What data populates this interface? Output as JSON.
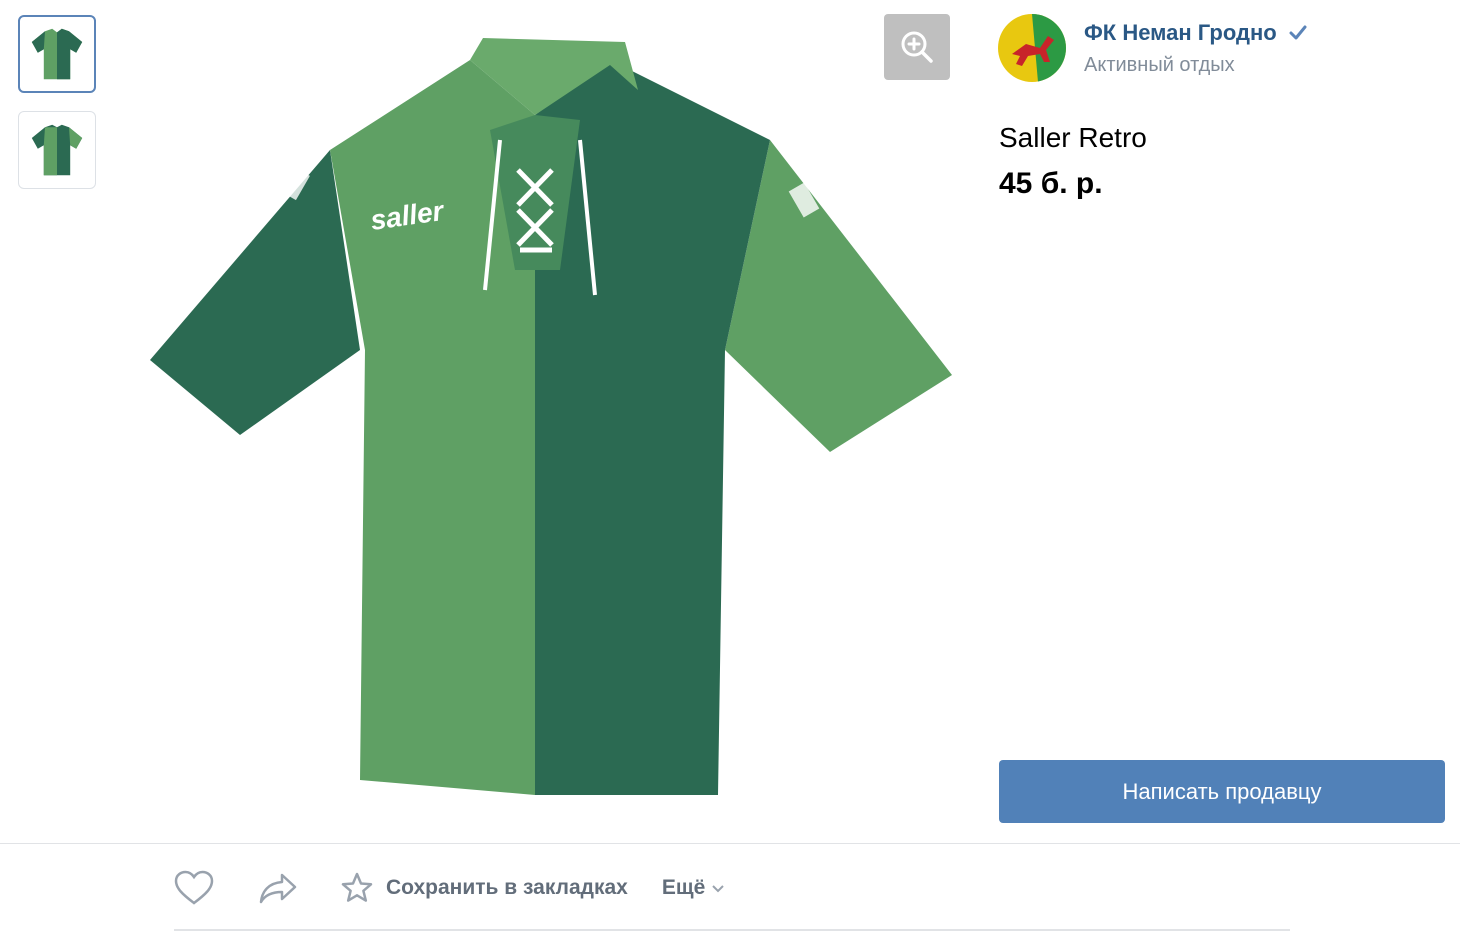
{
  "seller": {
    "name": "ФК Неман Гродно",
    "category": "Активный отдых",
    "verified": true
  },
  "product": {
    "title": "Saller Retro",
    "price": "45 б. р.",
    "jersey_brand_print": "saller"
  },
  "thumbnails": [
    {
      "name": "front-view",
      "active": true
    },
    {
      "name": "back-view",
      "active": false
    }
  ],
  "contact_button": "Написать продавцу",
  "actions": {
    "save_label": "Сохранить в закладках",
    "more_label": "Ещё"
  },
  "colors": {
    "light_green": "#5fa064",
    "dark_green": "#2b6a52",
    "link": "#2a5885",
    "button": "#5181b8"
  }
}
